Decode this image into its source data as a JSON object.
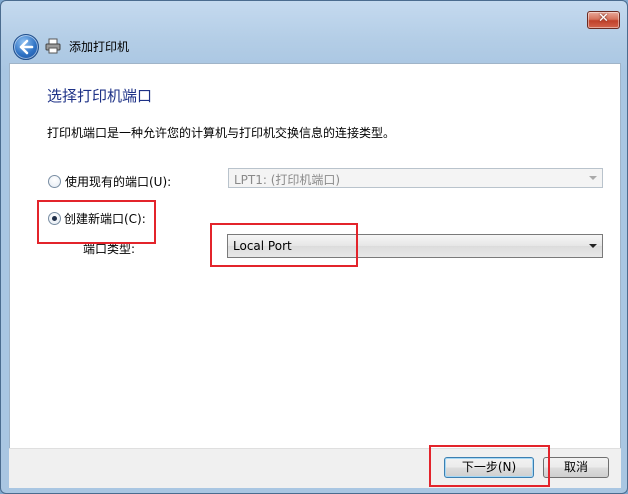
{
  "window": {
    "title": "添加打印机"
  },
  "icons": {
    "back": "back-arrow-icon",
    "printer": "printer-icon",
    "close": "close-icon"
  },
  "close_glyph": "✕",
  "page": {
    "heading": "选择打印机端口",
    "description": "打印机端口是一种允许您的计算机与打印机交换信息的连接类型。"
  },
  "options": {
    "use_existing": {
      "label": "使用现有的端口(U):",
      "selected": false,
      "value": "LPT1: (打印机端口)",
      "enabled": false
    },
    "create_new": {
      "label": "创建新端口(C):",
      "selected": true
    },
    "port_type": {
      "label": "端口类型:",
      "value": "Local Port"
    }
  },
  "buttons": {
    "next": "下一步(N)",
    "cancel": "取消"
  },
  "colors": {
    "heading": "#1e3287",
    "annotation": "#e3242b",
    "chrome": "#a9c6e2"
  }
}
